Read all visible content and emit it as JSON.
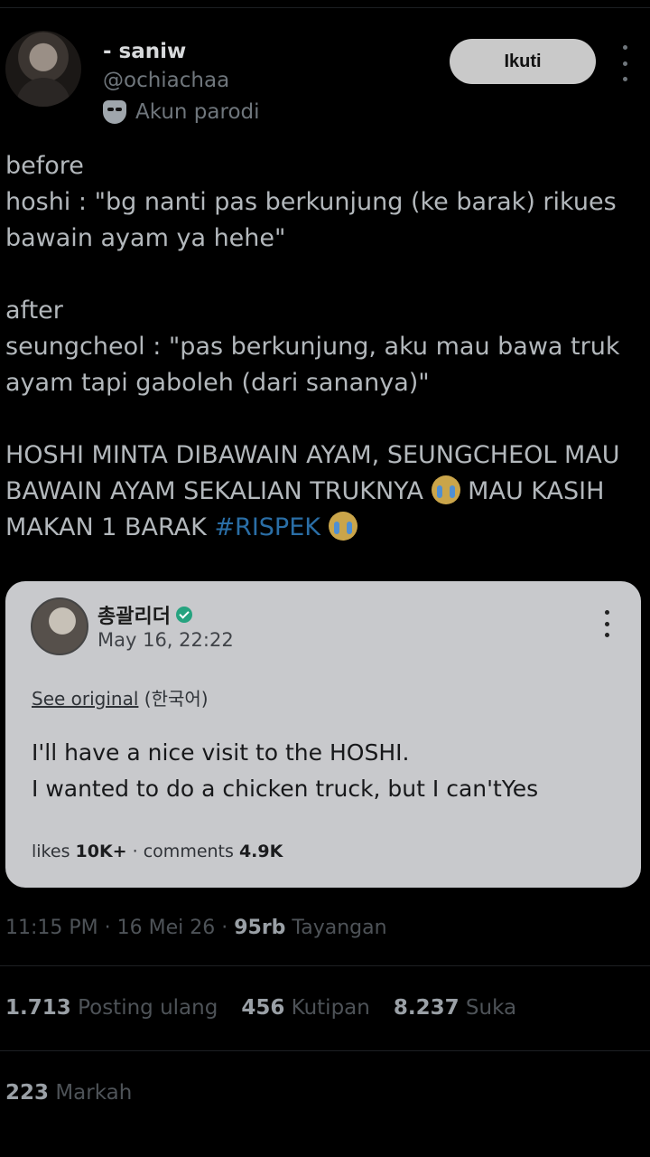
{
  "header": {
    "display_name": "- saniw",
    "handle": "@ochiachaa",
    "parody_label": "Akun parodi",
    "follow_label": "Ikuti"
  },
  "tweet": {
    "line1": "before",
    "line2": "hoshi : \"bg nanti pas berkunjung (ke barak) rikues bawain ayam ya hehe\"",
    "line3": "after",
    "line4": "seungcheol : \"pas berkunjung, aku mau bawa truk ayam tapi gaboleh (dari sananya)\"",
    "line5a": "HOSHI MINTA DIBAWAIN AYAM, SEUNGCHEOL MAU BAWAIN AYAM SEKALIAN TRUKNYA ",
    "line5b": " MAU KASIH MAKAN 1 BARAK ",
    "hashtag": "#RISPEK"
  },
  "quoted": {
    "name": "총괄리더",
    "date": "May 16, 22:22",
    "see_original": "See original",
    "lang": " (한국어)",
    "text_line1": "I'll have a nice visit to the HOSHI.",
    "text_line2": "I wanted to do a chicken truck, but I can'tYes",
    "likes_label": "likes ",
    "likes_value": "10K+",
    "sep": " · ",
    "comments_label": "comments ",
    "comments_value": "4.9K"
  },
  "meta": {
    "time": "11:15 PM · 16 Mei 26 · ",
    "views_value": "95rb",
    "views_label": " Tayangan"
  },
  "stats": {
    "reposts_value": "1.713",
    "reposts_label": " Posting ulang",
    "quotes_value": "456",
    "quotes_label": " Kutipan",
    "likes_value": "8.237",
    "likes_label": " Suka",
    "bookmarks_value": "223",
    "bookmarks_label": " Markah"
  },
  "icons": [
    "parody-mask-icon",
    "more-options-icon",
    "crying-emoji-icon",
    "verified-badge-icon"
  ],
  "colors": {
    "hashtag": "#2a6ea6",
    "card_bg": "#c8c9cc",
    "follow_bg": "#c9c9c9"
  }
}
